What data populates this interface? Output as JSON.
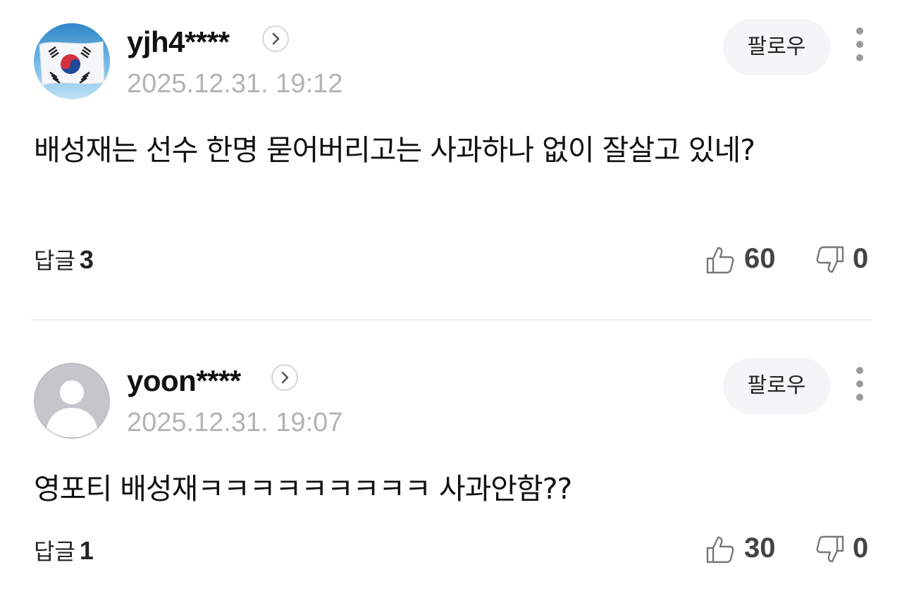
{
  "comments": [
    {
      "avatar": "korean-flag-avatar",
      "username": "yjh4****",
      "date": "2025.12.31. 19:12",
      "follow_label": "팔로우",
      "text": "배성재는 선수 한명 묻어버리고는 사과하나 없이 잘살고 있네?",
      "reply_label": "답글",
      "reply_count": "3",
      "likes": "60",
      "dislikes": "0"
    },
    {
      "avatar": "default-person-avatar",
      "username": "yoon****",
      "date": "2025.12.31. 19:07",
      "follow_label": "팔로우",
      "text": "영포티 배성재ㅋㅋㅋㅋㅋㅋㅋㅋㅋ 사과안함??",
      "reply_label": "답글",
      "reply_count": "1",
      "likes": "30",
      "dislikes": "0"
    }
  ],
  "icons": {
    "profile": "chevron-right-icon",
    "more": "more-vertical-icon",
    "like": "thumbs-up-icon",
    "dislike": "thumbs-down-icon"
  },
  "colors": {
    "date": "#b3b3b3",
    "follow_bg": "#f4f5f7",
    "divider": "#ececec"
  }
}
